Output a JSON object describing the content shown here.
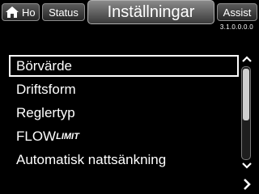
{
  "tabs": {
    "home_label": "Ho",
    "status_label": "Status",
    "settings_label": "Inställningar",
    "assist_label": "Assist"
  },
  "version": "3.1.0.0.0.0",
  "menu": {
    "items": [
      {
        "label": "Börvärde"
      },
      {
        "label": "Driftsform"
      },
      {
        "label": "Reglertyp"
      },
      {
        "label_main": "FLOW",
        "label_suffix": "LIMIT"
      },
      {
        "label": "Automatisk nattsänkning"
      }
    ],
    "selected_index": 0
  },
  "icons": {
    "home": "home-icon",
    "scroll_up": "chevron-up-icon",
    "scroll_down": "chevron-down-icon",
    "next": "chevron-right-icon"
  }
}
